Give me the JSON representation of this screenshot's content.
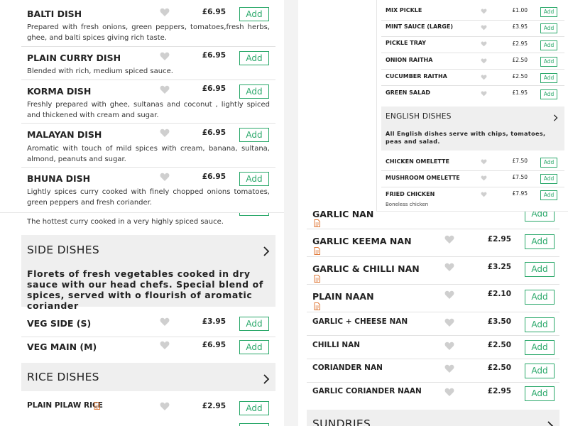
{
  "colors": {
    "accent": "#2aa86a",
    "heart": "#cfcfcf",
    "doc_icon": "#e07a3a"
  },
  "curries": [
    {
      "name": "BALTI DISH",
      "price": "£6.95",
      "add": "Add",
      "desc": "Prepared with fresh onions, green peppers, tomatoes,fresh herbs, ghee, and balti spices giving rich taste."
    },
    {
      "name": "PLAIN CURRY DISH",
      "price": "£6.95",
      "add": "Add",
      "desc": "Blended with rich, medium spiced sauce."
    },
    {
      "name": "KORMA DISH",
      "price": "£6.95",
      "add": "Add",
      "desc": "Freshly prepared with ghee, sultanas and coconut , lightly spiced and thickened with cream and sugar."
    },
    {
      "name": "MALAYAN DISH",
      "price": "£6.95",
      "add": "Add",
      "desc": "Aromatic with touch of mild spices with cream, banana, sultana, almond, peanuts and sugar."
    },
    {
      "name": "BHUNA DISH",
      "price": "£6.95",
      "add": "Add",
      "desc": "Lightly spices curry cooked with finely chopped onions tomatoes, green peppers and fresh coriander."
    }
  ],
  "hottest_desc": "The hottest curry cooked in a very highly spiced sauce.",
  "side_dishes": {
    "title": "SIDE DISHES",
    "desc": "Florets of fresh vegetables cooked in dry sauce with our head chefs. Special blend of spices, served with o flourish of aromatic coriander",
    "items": [
      {
        "name": "VEG SIDE (S)",
        "price": "£3.95",
        "add": "Add"
      },
      {
        "name": "VEG MAIN (M)",
        "price": "£6.95",
        "add": "Add"
      }
    ]
  },
  "rice_dishes": {
    "title": "RICE DISHES",
    "items": [
      {
        "name": "PLAIN PILAW RICE",
        "price": "£2.95",
        "add": "Add"
      }
    ]
  },
  "nans": [
    {
      "name": "GARLIC NAN",
      "add": "Add"
    },
    {
      "name": "GARLIC KEEMA NAN",
      "price": "£2.95",
      "add": "Add"
    },
    {
      "name": "GARLIC & CHILLI NAN",
      "price": "£3.25",
      "add": "Add"
    },
    {
      "name": "PLAIN NAAN",
      "price": "£2.10",
      "add": "Add"
    },
    {
      "name": "GARLIC + CHEESE NAN",
      "price": "£3.50",
      "add": "Add"
    },
    {
      "name": "CHILLI NAN",
      "price": "£2.50",
      "add": "Add"
    },
    {
      "name": "CORIANDER NAN",
      "price": "£2.50",
      "add": "Add"
    },
    {
      "name": "GARLIC CORIANDER NAAN",
      "price": "£2.95",
      "add": "Add"
    }
  ],
  "sundries": {
    "title": "SUNDRIES"
  },
  "small_panel": {
    "sides": [
      {
        "name": "MIX PICKLE",
        "price": "£1.00",
        "add": "Add"
      },
      {
        "name": "MINT SAUCE (LARGE)",
        "price": "£3.95",
        "add": "Add"
      },
      {
        "name": "PICKLE TRAY",
        "price": "£2.95",
        "add": "Add"
      },
      {
        "name": "ONION RAITHA",
        "price": "£2.50",
        "add": "Add"
      },
      {
        "name": "CUCUMBER RAITHA",
        "price": "£2.50",
        "add": "Add"
      },
      {
        "name": "GREEN SALAD",
        "price": "£1.95",
        "add": "Add"
      }
    ],
    "english": {
      "title": "ENGLISH DISHES",
      "desc": "All English dishes serve with chips, tomatoes, peas and salad.",
      "items": [
        {
          "name": "CHICKEN OMELETTE",
          "price": "£7.50",
          "add": "Add"
        },
        {
          "name": "MUSHROOM OMELETTE",
          "price": "£7.50",
          "add": "Add"
        },
        {
          "name": "FRIED CHICKEN",
          "price": "£7.95",
          "add": "Add",
          "sub": "Boneless chicken"
        }
      ]
    }
  }
}
